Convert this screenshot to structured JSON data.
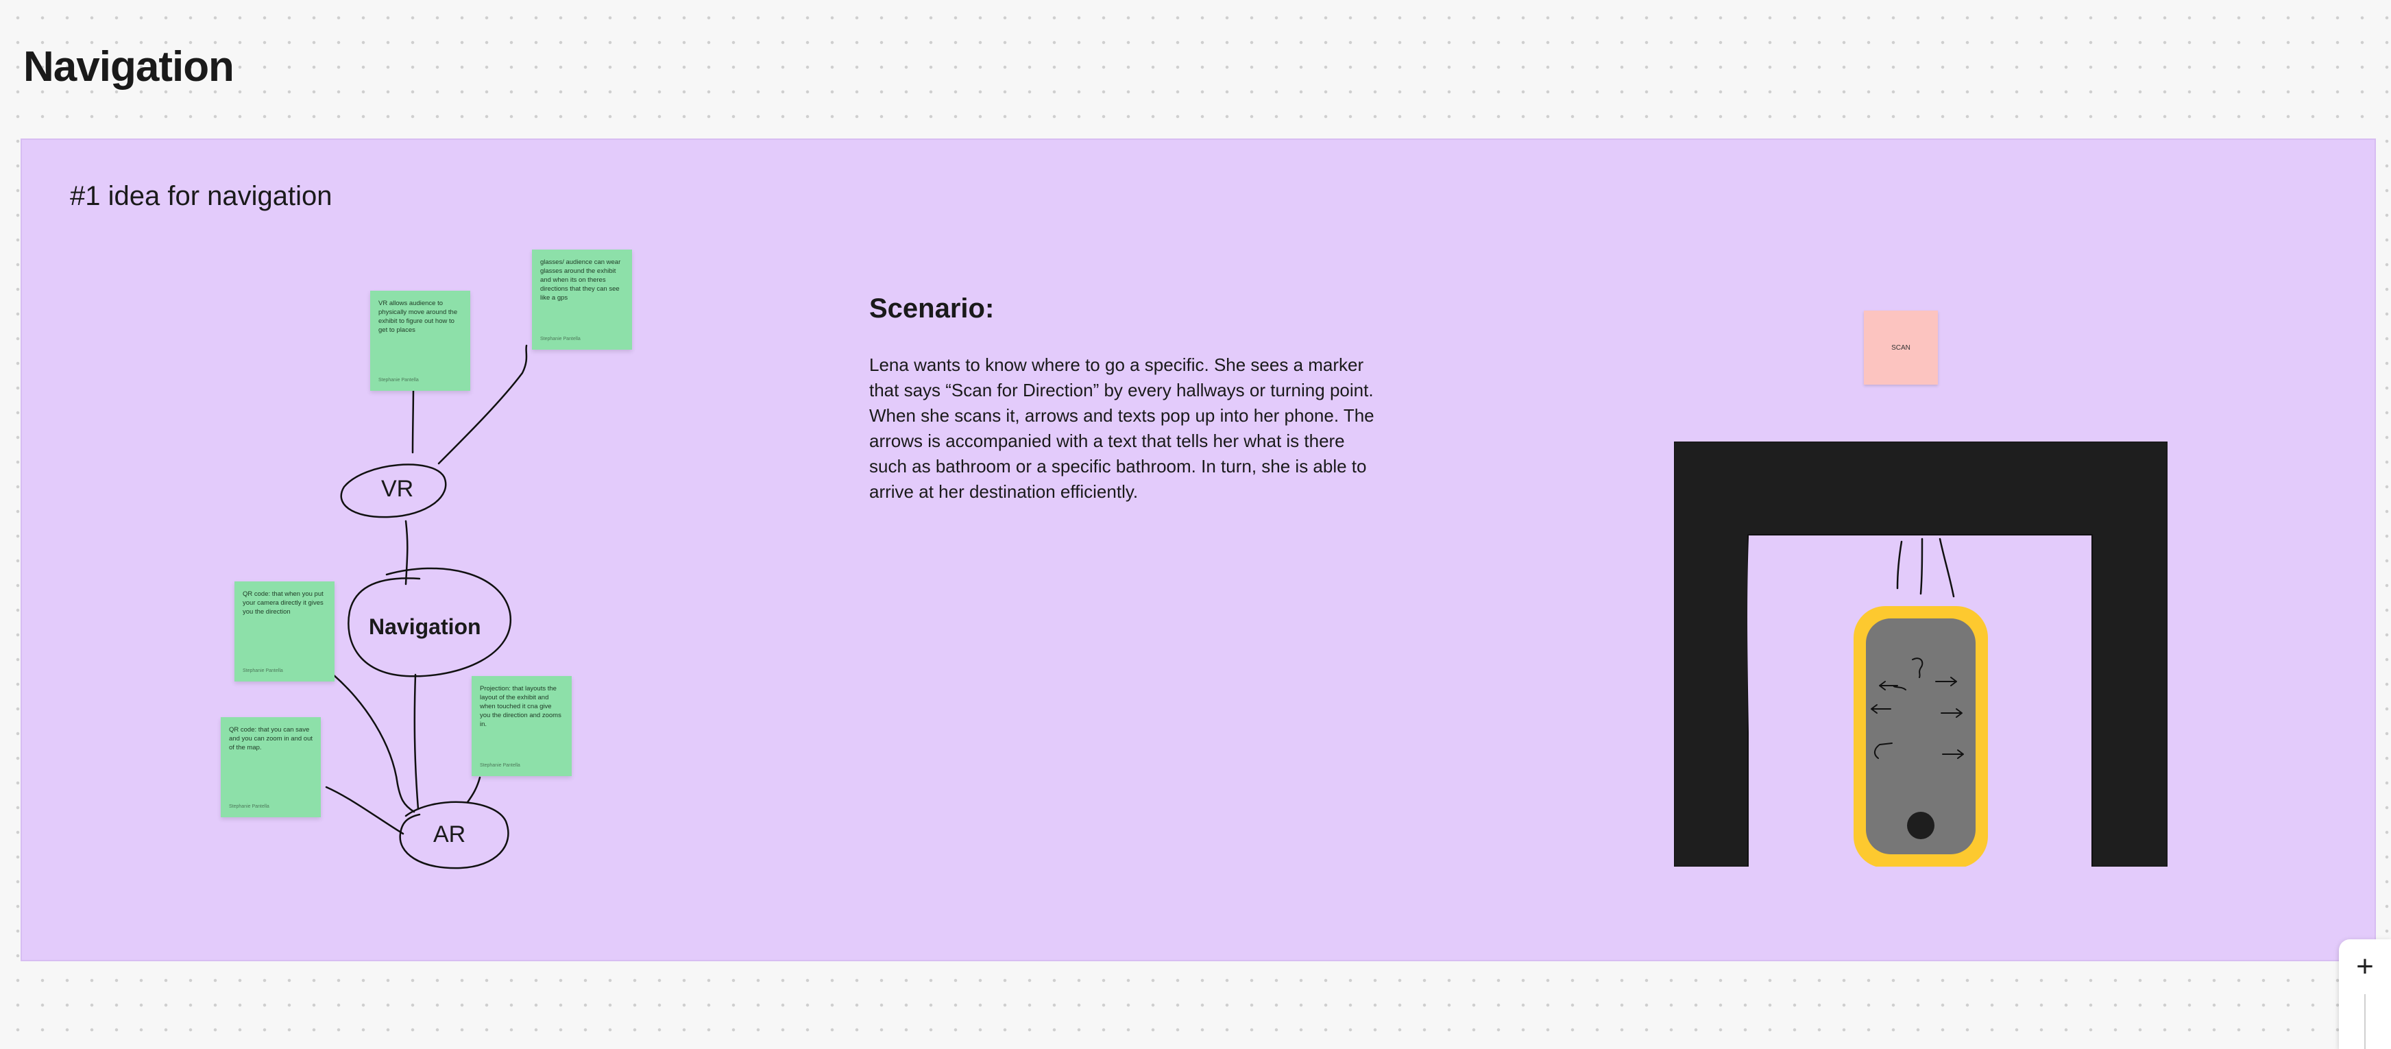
{
  "page": {
    "title": "Navigation"
  },
  "section": {
    "title": "#1 idea for navigation",
    "mindmap": {
      "center": "Navigation",
      "branches": [
        "VR",
        "AR"
      ],
      "notes": [
        {
          "text": "VR allows audience to physically move around the exhibit to figure out how to get to places",
          "author": "Stephanie Pantella"
        },
        {
          "text": "glasses/ audience can wear glasses around the exhibit and when its on theres directions that they can see like a gps",
          "author": "Stephanie Pantella"
        },
        {
          "text": "QR code: that when you put your camera directly it gives you the direction",
          "author": "Stephanie Pantella"
        },
        {
          "text": "Projection: that layouts the layout of the exhibit and when touched it cna give you the direction and zooms in.",
          "author": "Stephanie Pantella"
        },
        {
          "text": "QR code: that you can save and you can zoom in and out of the map.",
          "author": "Stephanie Pantella"
        }
      ]
    },
    "scenario": {
      "heading": "Scenario:",
      "body": "Lena wants to know where to go a specific. She sees a marker that says “Scan for Direction” by every hallways or turning point. When she scans it, arrows and texts pop up into her phone. The arrows is accompanied with a text that tells her what is there such as bathroom or a specific bathroom. In turn, she is able to arrive at her destination efficiently."
    },
    "illustration": {
      "scan_label": "SCAN",
      "colors": {
        "frame": "#1e1e1e",
        "phone_case": "#fdc92f",
        "screen": "#777777",
        "sticker": "#fcc4c0"
      }
    }
  },
  "zoom": {
    "plus_label": "+"
  },
  "colors": {
    "section_bg": "#e3cbfb",
    "sticky": "#8de0a9"
  }
}
